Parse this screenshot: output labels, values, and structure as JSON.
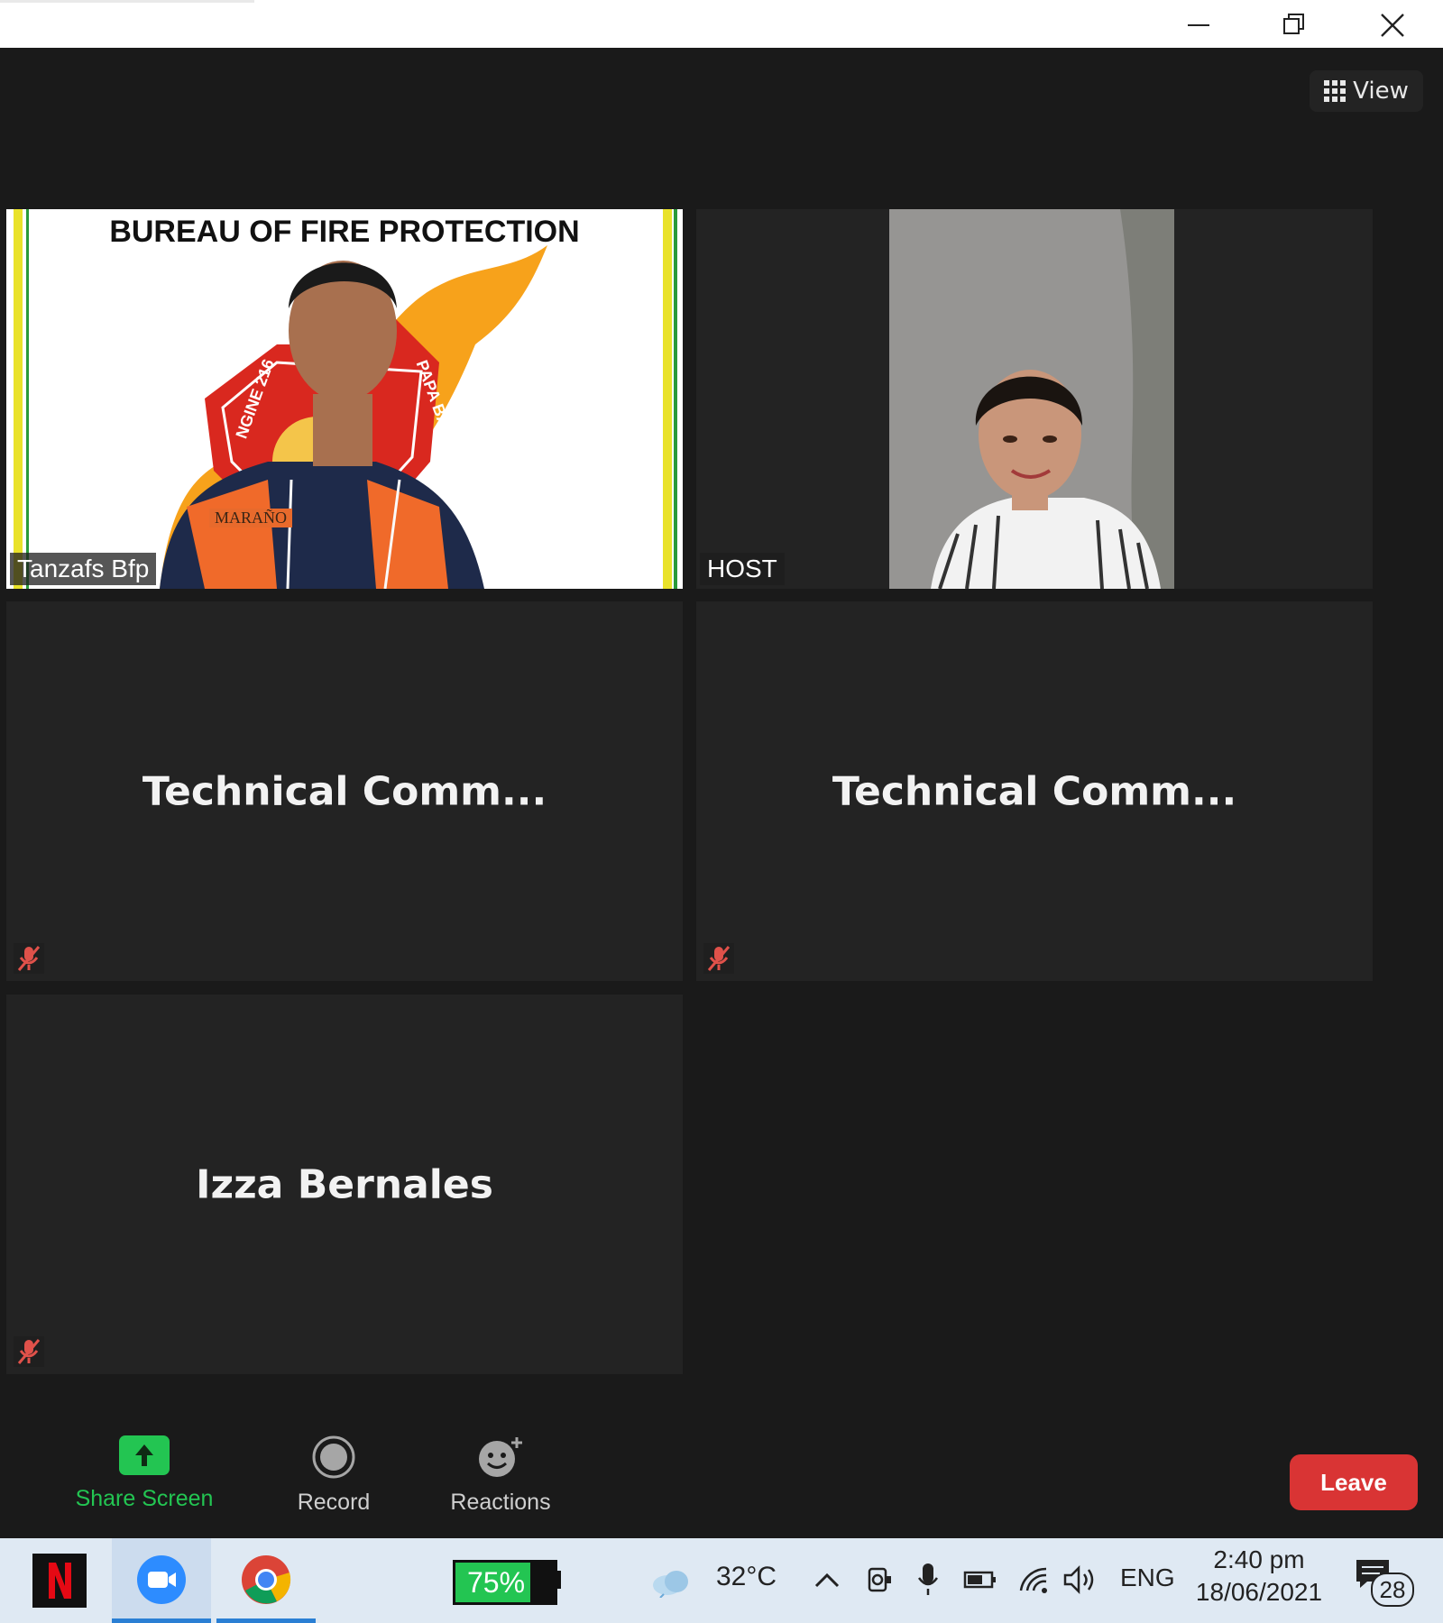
{
  "window": {
    "controls": [
      "minimize",
      "restore",
      "close"
    ]
  },
  "view_button": {
    "label": "View",
    "icon": "grid-icon"
  },
  "tiles": [
    {
      "name": "Tanzafs Bfp",
      "type": "video",
      "background_text": "BUREAU OF FIRE PROTECTION",
      "badge_left": "NGINE 216",
      "badge_right": "PAPA BAS",
      "name_patch": "MARAÑO"
    },
    {
      "name": "HOST",
      "type": "video"
    },
    {
      "name": "Technical  Comm...",
      "type": "avatar",
      "muted": true
    },
    {
      "name": "Technical  Comm...",
      "type": "avatar",
      "muted": true
    },
    {
      "name": "Izza Bernales",
      "type": "avatar",
      "muted": true
    }
  ],
  "toolbar": {
    "share_label": "Share Screen",
    "record_label": "Record",
    "reactions_label": "Reactions",
    "leave_label": "Leave",
    "colors": {
      "share": "#23c552",
      "leave": "#d93434"
    }
  },
  "taskbar": {
    "apps": [
      "netflix-icon",
      "zoom-icon",
      "chrome-icon"
    ],
    "battery_percent": "75%",
    "battery_level": 0.75,
    "weather": "32°C",
    "language": "ENG",
    "time": "2:40 pm",
    "date": "18/06/2021",
    "notifications": "28"
  }
}
